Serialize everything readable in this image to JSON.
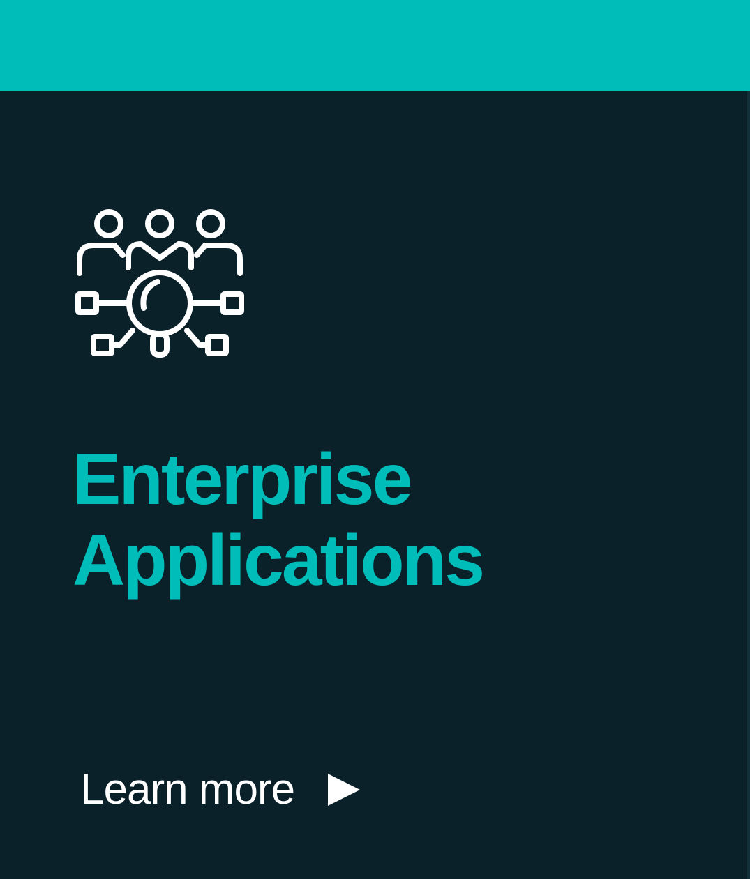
{
  "card": {
    "title_line1": "Enterprise",
    "title_line2": "Applications",
    "cta_label": "Learn more",
    "icon": "team-search-network-icon",
    "cta_icon": "play-arrow-icon"
  },
  "colors": {
    "accent": "#00bdb9",
    "background": "#0b212a",
    "cta_text": "#ffffff",
    "icon_stroke": "#ffffff"
  }
}
